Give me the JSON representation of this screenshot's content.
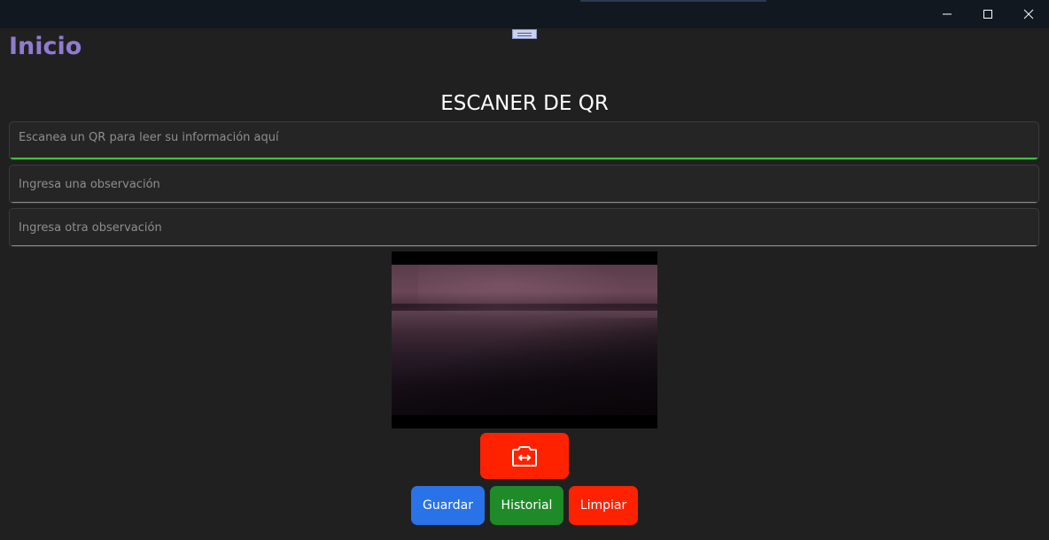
{
  "window": {
    "minimize_icon": "minimize-icon",
    "maximize_icon": "maximize-icon",
    "close_icon": "close-icon"
  },
  "page": {
    "title": "Inicio",
    "heading": "ESCANER DE QR"
  },
  "fields": {
    "qr_result": {
      "value": "",
      "placeholder": "Escanea un QR para leer su información aquí"
    },
    "observation_1": {
      "value": "",
      "placeholder": "Ingresa una observación"
    },
    "observation_2": {
      "value": "",
      "placeholder": "Ingresa otra observación"
    }
  },
  "camera": {
    "switch_icon": "switch-camera-icon"
  },
  "actions": {
    "save_label": "Guardar",
    "history_label": "Historial",
    "clear_label": "Limpiar"
  },
  "colors": {
    "title_accent": "#8f7ccf",
    "focus_underline": "#3cc43c",
    "save": "#2a72e8",
    "history": "#1e8a28",
    "clear": "#ff2200",
    "switch_camera": "#ff2200"
  }
}
